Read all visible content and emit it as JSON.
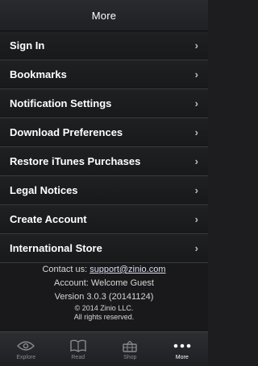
{
  "header": {
    "title": "More"
  },
  "menu": {
    "items": [
      {
        "label": "Sign In"
      },
      {
        "label": "Bookmarks"
      },
      {
        "label": "Notification Settings"
      },
      {
        "label": "Download Preferences"
      },
      {
        "label": "Restore iTunes Purchases"
      },
      {
        "label": "Legal Notices"
      },
      {
        "label": "Create Account"
      },
      {
        "label": "International Store"
      }
    ],
    "chevron": "›"
  },
  "footer": {
    "contact_prefix": "Contact us: ",
    "contact_email": "support@zinio.com",
    "account": "Account: Welcome Guest",
    "version": "Version 3.0.3 (20141124)",
    "copyright": "© 2014 Zinio LLC.",
    "rights": "All rights reserved."
  },
  "tabs": [
    {
      "label": "Explore",
      "icon": "eye-icon"
    },
    {
      "label": "Read",
      "icon": "book-icon"
    },
    {
      "label": "Shop",
      "icon": "basket-icon"
    },
    {
      "label": "More",
      "icon": "more-dots-icon",
      "active": true
    }
  ],
  "colors": {
    "background": "#19191b",
    "accent_active": "#ffffff",
    "inactive": "#8a8b8f"
  }
}
